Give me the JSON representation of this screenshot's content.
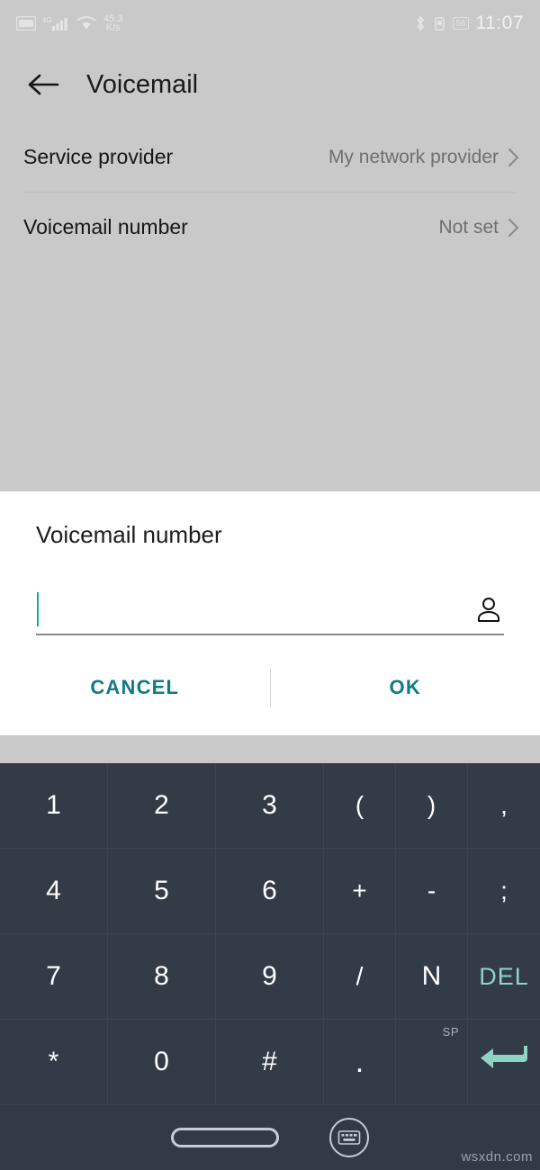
{
  "status_bar": {
    "sim_icon": "sim-card-icon",
    "signal_label": "4G",
    "signal_icon": "cellular-signal-icon",
    "wifi_icon": "wifi-icon",
    "network_speed_value": "45.3",
    "network_speed_unit": "K/s",
    "bluetooth_icon": "bluetooth-icon",
    "alarm_icon": "alarm-icon",
    "battery_level": "56",
    "battery_icon": "battery-icon",
    "time": "11:07"
  },
  "app_bar": {
    "back_icon": "back-arrow-icon",
    "title": "Voicemail"
  },
  "settings_list": {
    "rows": [
      {
        "label": "Service provider",
        "value": "My network provider",
        "chevron": "chevron-right-icon"
      },
      {
        "label": "Voicemail number",
        "value": "Not set",
        "chevron": "chevron-right-icon"
      }
    ]
  },
  "dialog": {
    "title": "Voicemail number",
    "input_value": "",
    "input_placeholder": "",
    "contact_icon": "person-contact-icon",
    "cancel_label": "CANCEL",
    "ok_label": "OK",
    "accent_color": "#0f7b87",
    "caret_color": "#1fa5a5"
  },
  "keyboard": {
    "accent_color": "#8fd4c4",
    "background_color": "#323a45",
    "rows": [
      [
        {
          "label": "1",
          "name": "key-1",
          "width": "wide"
        },
        {
          "label": "2",
          "name": "key-2",
          "width": "wide"
        },
        {
          "label": "3",
          "name": "key-3",
          "width": "wide"
        },
        {
          "label": "(",
          "name": "key-paren-open",
          "width": "narrow"
        },
        {
          "label": ")",
          "name": "key-paren-close",
          "width": "narrow"
        },
        {
          "label": ",",
          "name": "key-comma",
          "width": "narrow"
        }
      ],
      [
        {
          "label": "4",
          "name": "key-4",
          "width": "wide"
        },
        {
          "label": "5",
          "name": "key-5",
          "width": "wide"
        },
        {
          "label": "6",
          "name": "key-6",
          "width": "wide"
        },
        {
          "label": "+",
          "name": "key-plus",
          "width": "narrow"
        },
        {
          "label": "-",
          "name": "key-minus",
          "width": "narrow"
        },
        {
          "label": ";",
          "name": "key-semicolon",
          "width": "narrow"
        }
      ],
      [
        {
          "label": "7",
          "name": "key-7",
          "width": "wide"
        },
        {
          "label": "8",
          "name": "key-8",
          "width": "wide"
        },
        {
          "label": "9",
          "name": "key-9",
          "width": "wide"
        },
        {
          "label": "/",
          "name": "key-slash",
          "width": "narrow"
        },
        {
          "label": "N",
          "name": "key-n",
          "width": "narrow"
        },
        {
          "label": "DEL",
          "name": "key-delete",
          "width": "narrow",
          "accent": true
        }
      ],
      [
        {
          "label": "*",
          "name": "key-asterisk",
          "width": "wide"
        },
        {
          "label": "0",
          "name": "key-0",
          "width": "wide"
        },
        {
          "label": "#",
          "name": "key-hash",
          "width": "wide"
        },
        {
          "label": ".",
          "name": "key-period",
          "width": "narrow"
        },
        {
          "label": "",
          "name": "key-space",
          "width": "narrow",
          "sup": "SP"
        },
        {
          "label": "",
          "name": "key-enter",
          "width": "narrow",
          "icon": "enter-return-icon"
        }
      ]
    ]
  },
  "nav_bar": {
    "home_indicator": "home-pill-icon",
    "keyboard_hide_icon": "hide-keyboard-icon"
  },
  "watermark": {
    "text": "wsxdn.com"
  }
}
